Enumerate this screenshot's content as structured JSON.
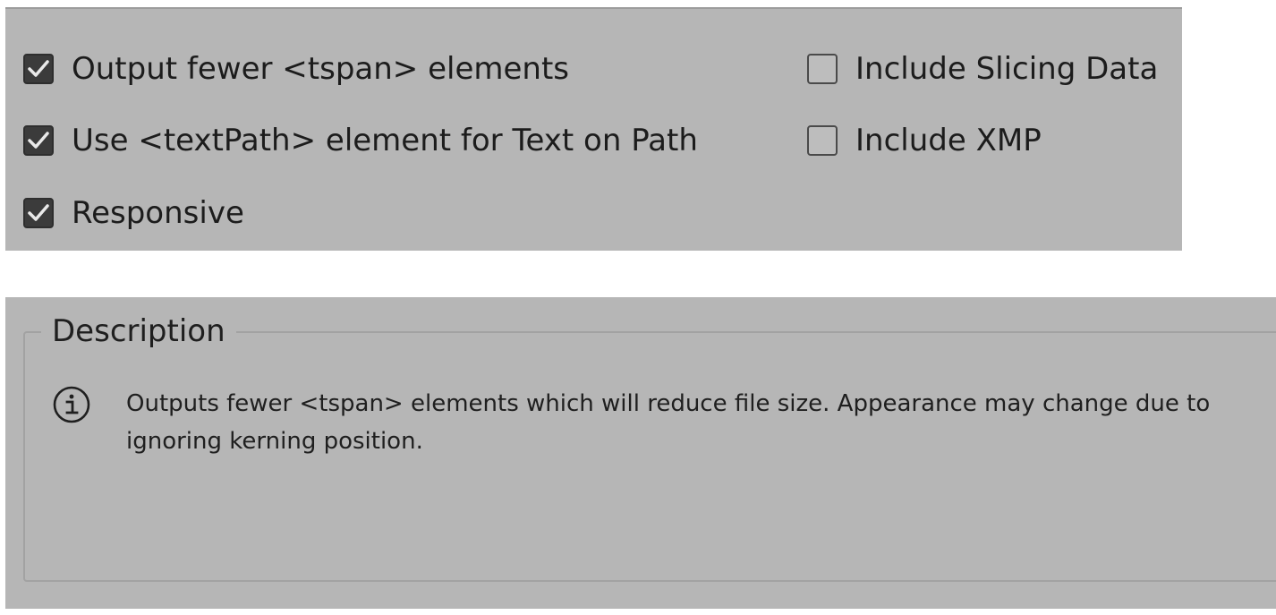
{
  "options": {
    "left_column": [
      {
        "label": "Output fewer <tspan> elements",
        "checked": true
      },
      {
        "label": "Use <textPath> element for Text on Path",
        "checked": true
      },
      {
        "label": "Responsive",
        "checked": true
      }
    ],
    "right_column": [
      {
        "label": "Include Slicing Data",
        "checked": false
      },
      {
        "label": "Include XMP",
        "checked": false
      }
    ]
  },
  "description": {
    "legend": "Description",
    "icon": "info-icon",
    "text": "Outputs fewer <tspan> elements which will reduce file size. Appearance may change due to ignoring kerning position."
  },
  "colors": {
    "panel_background": "#b6b6b6",
    "checkbox_checked": "#3b3b3b",
    "text": "#1f1f1f"
  }
}
